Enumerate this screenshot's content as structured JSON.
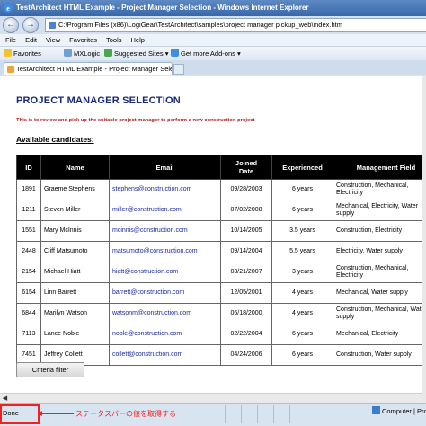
{
  "window": {
    "title": "TestArchitect HTML Example - Project Manager Selection - Windows Internet Explorer"
  },
  "address": {
    "url": "C:\\Program Files (x86)\\LogiGear\\TestArchitect\\samples\\project manager pickup_web\\index.htm"
  },
  "menu": [
    "File",
    "Edit",
    "View",
    "Favorites",
    "Tools",
    "Help"
  ],
  "favorites": {
    "label": "Favorites",
    "items": [
      "MXLogic",
      "Suggested Sites ▾",
      "Get more Add-ons ▾"
    ]
  },
  "tab": {
    "label": "TestArchitect HTML Example - Project Manager Selection"
  },
  "page": {
    "title": "PROJECT MANAGER SELECTION",
    "description": "This is to review and pick up the suitable project manager to perform a new construction project",
    "available_label": "Available candidates:",
    "criteria_button": "Criteria filter"
  },
  "table": {
    "headers": [
      "ID",
      "Name",
      "Email",
      "Joined\nDate",
      "Experienced",
      "Management Field"
    ],
    "rows": [
      [
        "1891",
        "Graeme Stephens",
        "stephens@construction.com",
        "09/28/2003",
        "6 years",
        "Construction, Mechanical, Electricity"
      ],
      [
        "1211",
        "Steven Miller",
        "miller@construction.com",
        "07/02/2008",
        "6 years",
        "Mechanical, Electricity, Water supply"
      ],
      [
        "1551",
        "Mary McInnis",
        "mcinnis@construction.com",
        "10/14/2005",
        "3.5 years",
        "Construction, Electricity"
      ],
      [
        "2448",
        "Cliff Matsumoto",
        "matsumoto@construction.com",
        "09/14/2004",
        "5.5 years",
        "Electricity, Water supply"
      ],
      [
        "2154",
        "Michael Hiatt",
        "hiatt@construction.com",
        "03/21/2007",
        "3 years",
        "Construction, Mechanical, Electricity"
      ],
      [
        "6154",
        "Linn Barrett",
        "barrett@construction.com",
        "12/05/2001",
        "4 years",
        "Mechanical, Water supply"
      ],
      [
        "6844",
        "Marilyn Watson",
        "watsonm@construction.com",
        "06/18/2000",
        "4 years",
        "Construction, Mechanical, Water supply"
      ],
      [
        "7113",
        "Lance Noble",
        "noble@construction.com",
        "02/22/2004",
        "6 years",
        "Mechanical, Electricity"
      ],
      [
        "7451",
        "Jeffrey Collett",
        "collett@construction.com",
        "04/24/2006",
        "6 years",
        "Construction, Water supply"
      ]
    ]
  },
  "status": {
    "text": "Done",
    "annotation": "ステータスバーの値を取得する",
    "zone": "Computer | Prot"
  },
  "colors": {
    "title_blue": "#1a2a7a",
    "desc_red": "#b01a1a",
    "annot_red": "#ee2222",
    "header_black": "#000000"
  }
}
